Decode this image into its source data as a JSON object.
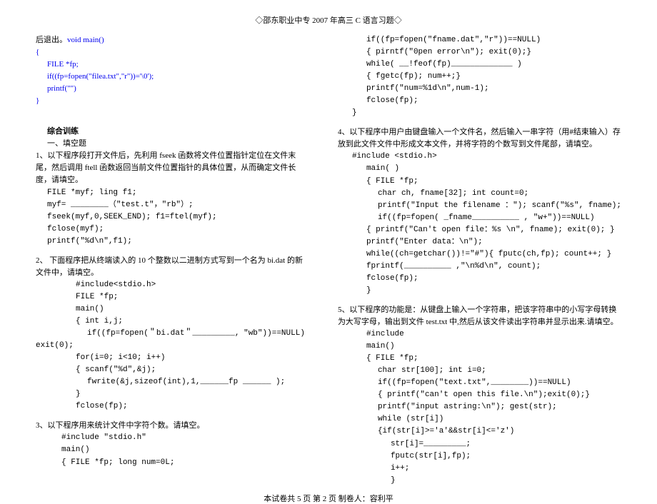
{
  "header": "◇邵东职业中专 2007 年高三 C 语言习题◇",
  "footer": "本试卷共 5 页  第 2 页     制卷人：容利平",
  "col1": {
    "l0": "后退出。void main()",
    "l1": "{",
    "l2": "FILE *fp;",
    "l3": "if((fp=fopen(\"filea.txt\",\"r\"))='\\0');",
    "l4": "printf(\"\")",
    "l5": "}",
    "sec_title": "综合训练",
    "sub_title": "一、填空题",
    "q1a": "1、以下程序段打开文件后，先利用 fseek 函数将文件位置指针定位在文件末尾，然后调用 ftell 函数返回当前文件位置指针的具体位置，从而确定文件长度，请填空。",
    "q1_c1": "FILE  *myf;   ling  f1;",
    "q1_c2": "myf= ________（\"test.t\"，\"rb\"）;",
    "q1_c3": "fseek(myf,0,SEEK_END); f1=ftel(myf);",
    "q1_c4": "fclose(myf);",
    "q1_c5": "printf(\"%d\\n\",f1);",
    "q2a": "2、 下面程序把从终端读入的 10 个整数以二进制方式写到一个名为 bi.dat 的新文件中，请填空。",
    "q2_c1": "#include<stdio.h>",
    "q2_c2": "FILE  *fp;",
    "q2_c3": "main()",
    "q2_c4": "{ int i,j;",
    "q2_c5a": "if((fp=fopen(＂bi.dat＂_________,",
    "q2_c5b": "″wb″))==NULL) ",
    "q2_c5c": "exit(0);",
    "q2_c6": "for(i=0;  i<10; i++)",
    "q2_c7": "{  scanf(″%d″,&j);",
    "q2_c8": "fwrite(&j,sizeof(int),1,______fp ______   );",
    "q2_c9": "}",
    "q2_c10": "fclose(fp);",
    "q3a": "3、以下程序用来统计文件中字符个数。请填空。",
    "q3_c1": "#include  \"stdio.h\"",
    "q3_c2": "main()",
    "q3_c3": "{ FILE  *fp;   long  num=0L;"
  },
  "col2": {
    "r0": "if((fp=fopen(\"fname.dat\",\"r\"))==NULL)",
    "r1": "{  pirntf(\"0pen error\\n\");  exit(0);}",
    "r2": "while(  __!feof(fp)_____________ )",
    "r3": "{ fgetc(fp); num++;}",
    "r4": "printf(\"num=%1d\\n\",num-1);",
    "r5": "fclose(fp);",
    "r6": "}",
    "q4a": "4、以下程序中用户由键盘输入一个文件名，然后输入一串字符（用#结束输入）存放到此文件文件中形成文本文件，并将字符的个数写到文件尾部，请填空。",
    "q4_c1": "#include <stdio.h>",
    "q4_c2": "main(  )",
    "q4_c3": "{     FILE   *fp;",
    "q4_c4": "char   ch, fname[32];   int   count=0;",
    "q4_c5": "printf(\"Input the filename ：\");  scanf(\"%s\", fname);",
    "q4_c6": "if((fp=fopen( _fname__________ , \"w+\"))==NULL)",
    "q4_c7": "{    printf(\"Can't open file：%s \\n\", fname);  exit(0);  }",
    "q4_c8": "printf(\"Enter data：\\n\");",
    "q4_c9": "while((ch=getchar())!=″#″){   fputc(ch,fp);   count++; }",
    "q4_c10": "fprintf(__________ ,\"\\n%d\\n\",  count);",
    "q4_c11": "fclose(fp);",
    "q4_c12": "}",
    "q5a": "5、以下程序的功能是：从键盘上输入一个字符串，把该字符串中的小写字母转换为大写字母，输出到文件 test.txt 中,然后从该文件读出字符串并显示出来.请填空。",
    "q5_c1": "#include",
    "q5_c2": "main()",
    "q5_c3": "{ FILE    *fp;",
    "q5_c4": "char   str[100];   int   i=0;",
    "q5_c5": "if((fp=fopen(\"text.txt\",________))==NULL)",
    "q5_c6": "{ printf(\"can't open this file.\\n\");exit(0);}",
    "q5_c7": "printf(\"input astring:\\n\");   gest(str);",
    "q5_c8": "while (str[i])",
    "q5_c9": "{if(str[i]>='a'&&str[i]<='z')",
    "q5_c10": "str[i]=_________;",
    "q5_c11": "fputc(str[i],fp);",
    "q5_c12": "i++;",
    "q5_c13": "}"
  }
}
